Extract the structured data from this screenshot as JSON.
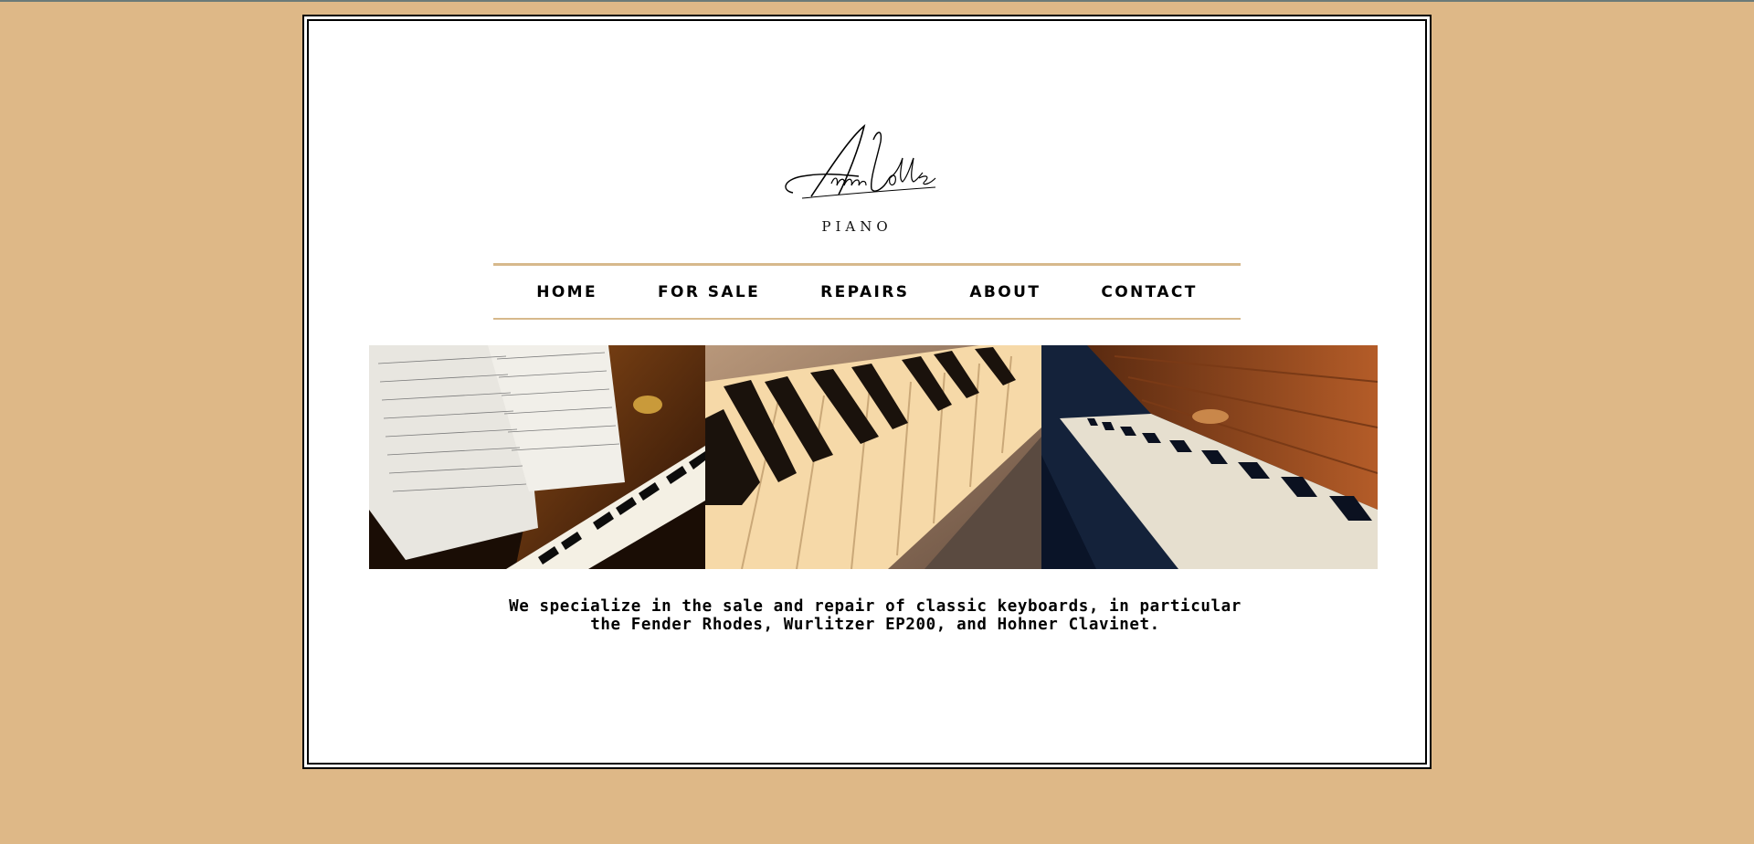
{
  "brand": {
    "name": "AnnaLotte",
    "subtitle": "PIANO"
  },
  "nav": {
    "items": [
      {
        "label": "HOME"
      },
      {
        "label": "FOR SALE"
      },
      {
        "label": "REPAIRS"
      },
      {
        "label": "ABOUT"
      },
      {
        "label": "CONTACT"
      }
    ]
  },
  "gallery": {
    "images": [
      {
        "name": "sheet-music-upright-piano-photo"
      },
      {
        "name": "piano-keys-closeup-photo"
      },
      {
        "name": "wooden-piano-keyboard-photo"
      }
    ]
  },
  "tagline": {
    "line1": "We specialize in the sale and repair of classic keyboards, in particular",
    "line2": "the Fender Rhodes, Wurlitzer EP200, and Hohner Clavinet."
  },
  "colors": {
    "page_background": "#deb887",
    "nav_rule": "#d7b98c",
    "panel": "#ffffff",
    "text": "#000000"
  }
}
